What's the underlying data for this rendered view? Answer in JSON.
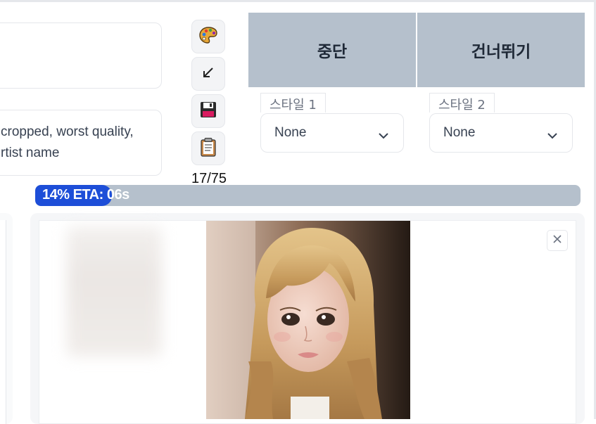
{
  "prompt": {
    "positive_text": "",
    "negative_lines": [
      "cropped, worst quality,",
      "rtist name"
    ]
  },
  "tools": {
    "icons": [
      "palette-icon",
      "arrow-down-left-icon",
      "floppy-disk-icon",
      "clipboard-icon"
    ],
    "token_counter": "17/75"
  },
  "actions": {
    "interrupt_label": "중단",
    "skip_label": "건너뛰기"
  },
  "styles": {
    "style1_label": "스타일 1",
    "style1_value": "None",
    "style2_label": "스타일 2",
    "style2_value": "None"
  },
  "progress": {
    "text": "14% ETA: 06s",
    "percent": 14
  },
  "gallery": {
    "close_icon": "close-icon"
  },
  "colors": {
    "button_bg": "#b5c0cc",
    "progress_fill": "#1d4ed8"
  }
}
